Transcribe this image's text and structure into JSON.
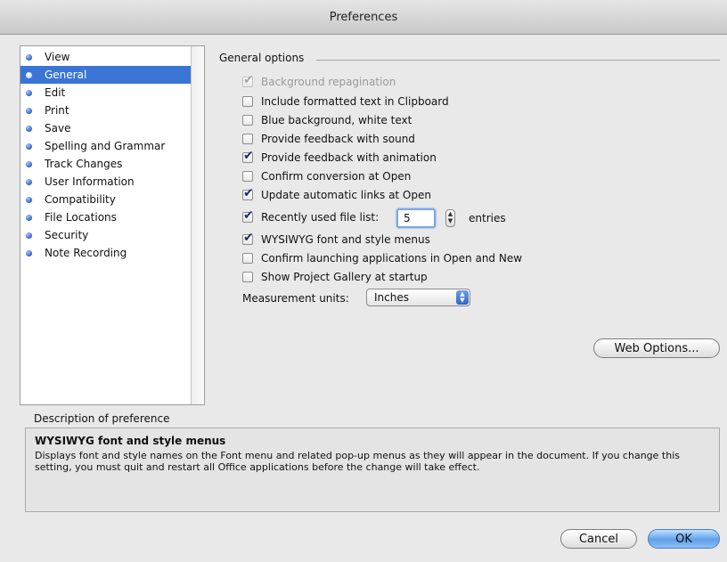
{
  "window": {
    "title": "Preferences"
  },
  "sidebar": {
    "items": [
      {
        "label": "View",
        "selected": false
      },
      {
        "label": "General",
        "selected": true
      },
      {
        "label": "Edit",
        "selected": false
      },
      {
        "label": "Print",
        "selected": false
      },
      {
        "label": "Save",
        "selected": false
      },
      {
        "label": "Spelling and Grammar",
        "selected": false
      },
      {
        "label": "Track Changes",
        "selected": false
      },
      {
        "label": "User Information",
        "selected": false
      },
      {
        "label": "Compatibility",
        "selected": false
      },
      {
        "label": "File Locations",
        "selected": false
      },
      {
        "label": "Security",
        "selected": false
      },
      {
        "label": "Note Recording",
        "selected": false
      }
    ]
  },
  "general": {
    "group_title": "General options",
    "options": [
      {
        "label": "Background repagination",
        "checked": true,
        "disabled": true
      },
      {
        "label": "Include formatted text in Clipboard",
        "checked": false,
        "disabled": false
      },
      {
        "label": "Blue background, white text",
        "checked": false,
        "disabled": false
      },
      {
        "label": "Provide feedback with sound",
        "checked": false,
        "disabled": false
      },
      {
        "label": "Provide feedback with animation",
        "checked": true,
        "disabled": false
      },
      {
        "label": "Confirm conversion at Open",
        "checked": false,
        "disabled": false
      },
      {
        "label": "Update automatic links at Open",
        "checked": true,
        "disabled": false
      },
      {
        "label": "Recently used file list:",
        "checked": true,
        "disabled": false
      },
      {
        "label": "WYSIWYG font and style menus",
        "checked": true,
        "disabled": false
      },
      {
        "label": "Confirm launching applications in Open and New",
        "checked": false,
        "disabled": false
      },
      {
        "label": "Show Project Gallery at startup",
        "checked": false,
        "disabled": false
      }
    ],
    "recent_files_count": "5",
    "entries_label": "entries",
    "measurement_label": "Measurement units:",
    "measurement_value": "Inches",
    "web_options_label": "Web Options..."
  },
  "description": {
    "label": "Description of preference",
    "title": "WYSIWYG font and style menus",
    "body": "Displays font and style names on the Font menu and related pop-up menus as they will appear in the document.  If you change this setting, you must quit and restart all Office applications before the change will take effect."
  },
  "footer": {
    "cancel_label": "Cancel",
    "ok_label": "OK"
  }
}
